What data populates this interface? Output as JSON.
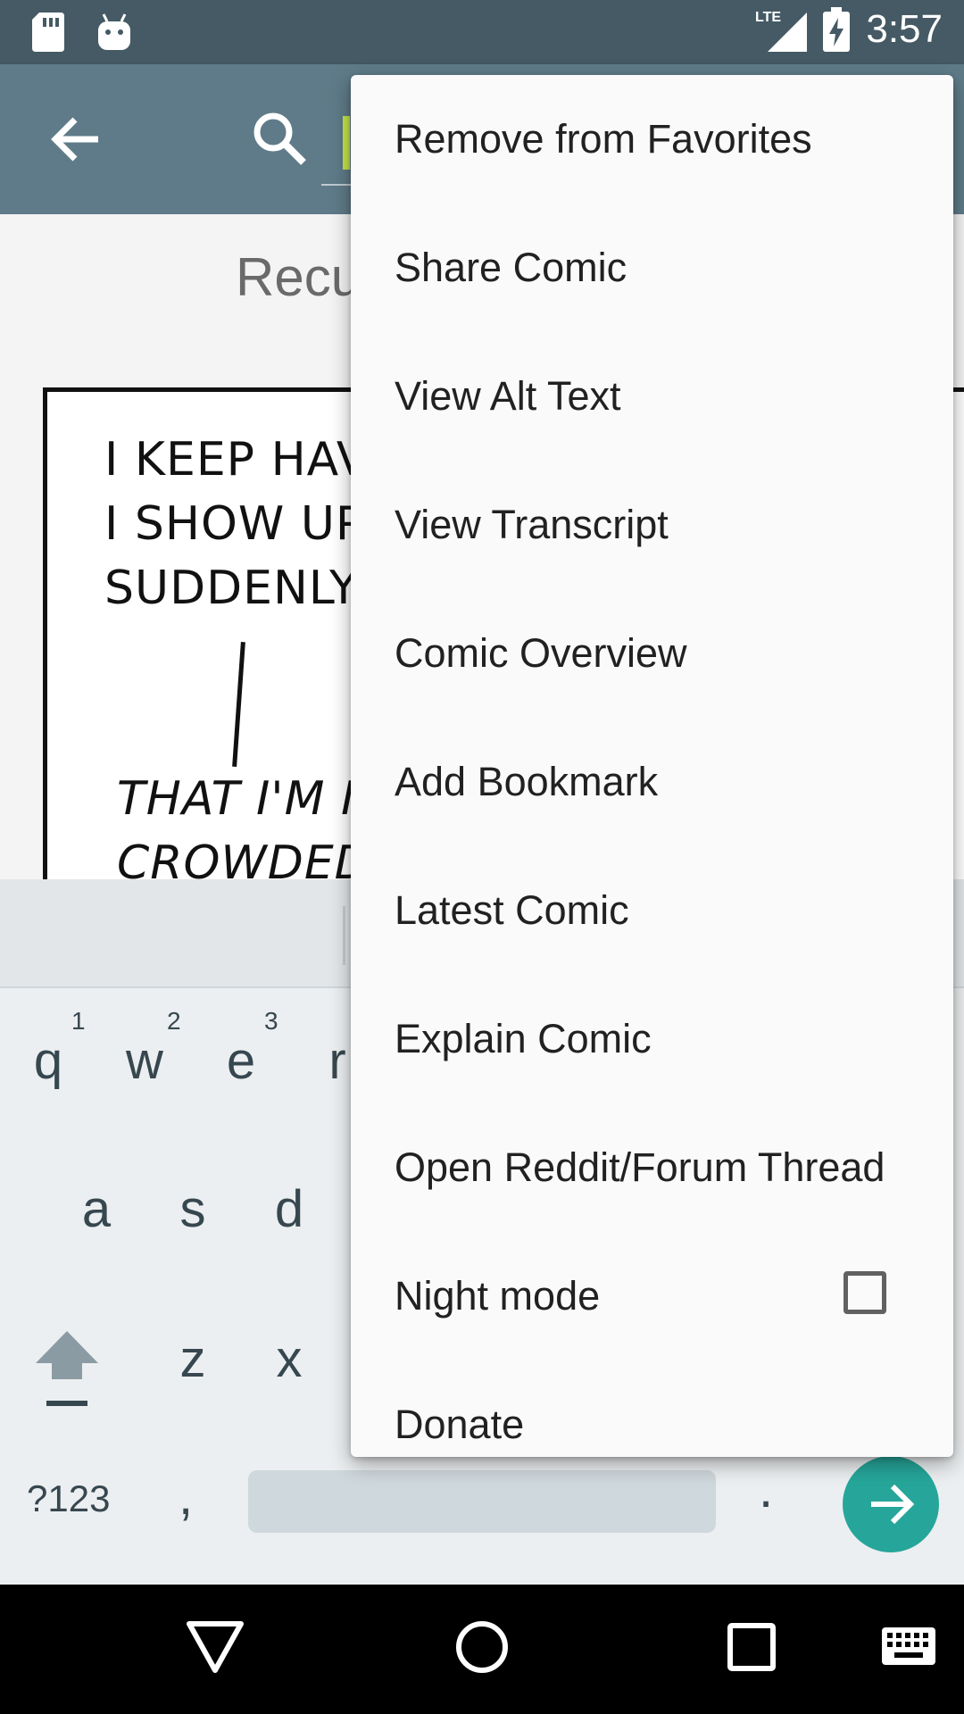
{
  "status_bar": {
    "time": "3:57",
    "network": "LTE",
    "left_icons": [
      "sd-card-icon",
      "android-debug-icon"
    ],
    "right_icons": [
      "lte-signal-icon",
      "battery-charging-icon"
    ]
  },
  "app_bar": {
    "back_icon": "arrow-back-icon",
    "search_icon": "search-icon",
    "search_value": ""
  },
  "content": {
    "comic_title": "Recu",
    "comic_panel_text_1": "I KEEP HAV\nI SHOW UP\nSUDDENLY F",
    "comic_panel_text_2": "THAT I'M I\nCROWDED F"
  },
  "keyboard": {
    "row1": [
      {
        "key": "q",
        "hint": "1"
      },
      {
        "key": "w",
        "hint": "2"
      },
      {
        "key": "e",
        "hint": "3"
      },
      {
        "key": "r",
        "hint": ""
      }
    ],
    "row2": [
      "a",
      "s",
      "d"
    ],
    "row3": [
      "z",
      "x"
    ],
    "symbols_label": "?123",
    "comma": ",",
    "period": "."
  },
  "menu": {
    "items": [
      {
        "label": "Remove from Favorites"
      },
      {
        "label": "Share Comic"
      },
      {
        "label": "View Alt Text"
      },
      {
        "label": "View Transcript"
      },
      {
        "label": "Comic Overview"
      },
      {
        "label": "Add Bookmark"
      },
      {
        "label": "Latest Comic"
      },
      {
        "label": "Explain Comic"
      },
      {
        "label": "Open Reddit/Forum Thread"
      },
      {
        "label": "Night mode",
        "checkbox": true,
        "checked": false
      },
      {
        "label": "Donate"
      }
    ]
  },
  "colors": {
    "status_bar": "#455a64",
    "app_bar": "#5f7b89",
    "enter_key": "#26a69a",
    "cursor": "#c6e34a"
  }
}
